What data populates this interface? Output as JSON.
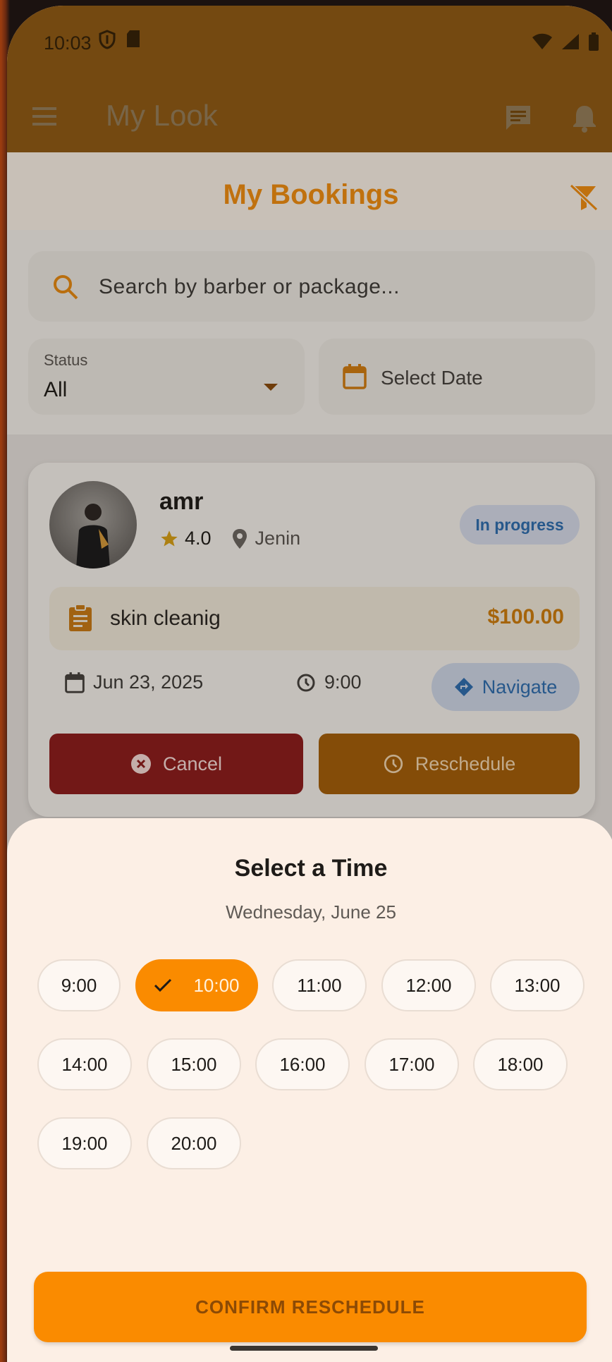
{
  "status_bar": {
    "time": "10:03"
  },
  "app_bar": {
    "title": "My Look"
  },
  "header": {
    "title": "My Bookings"
  },
  "search": {
    "placeholder": "Search by barber or package..."
  },
  "status_filter": {
    "label": "Status",
    "value": "All"
  },
  "date_filter": {
    "label": "Select Date"
  },
  "booking": {
    "barber_name": "amr",
    "rating": "4.0",
    "location": "Jenin",
    "status": "In progress",
    "package": "skin cleanig",
    "price": "$100.00",
    "date": "Jun 23, 2025",
    "time": "9:00",
    "navigate_label": "Navigate",
    "cancel_label": "Cancel",
    "reschedule_label": "Reschedule"
  },
  "sheet": {
    "title": "Select a Time",
    "subtitle": "Wednesday, June 25",
    "slots": [
      "9:00",
      "10:00",
      "11:00",
      "12:00",
      "13:00",
      "14:00",
      "15:00",
      "16:00",
      "17:00",
      "18:00",
      "19:00",
      "20:00"
    ],
    "selected_slot": "10:00",
    "confirm_label": "CONFIRM RESCHEDULE"
  },
  "colors": {
    "accent": "#fa8b00",
    "appbar": "#f39b29",
    "cancel": "#8e1c1c",
    "status_badge_text": "#2d6db0"
  }
}
